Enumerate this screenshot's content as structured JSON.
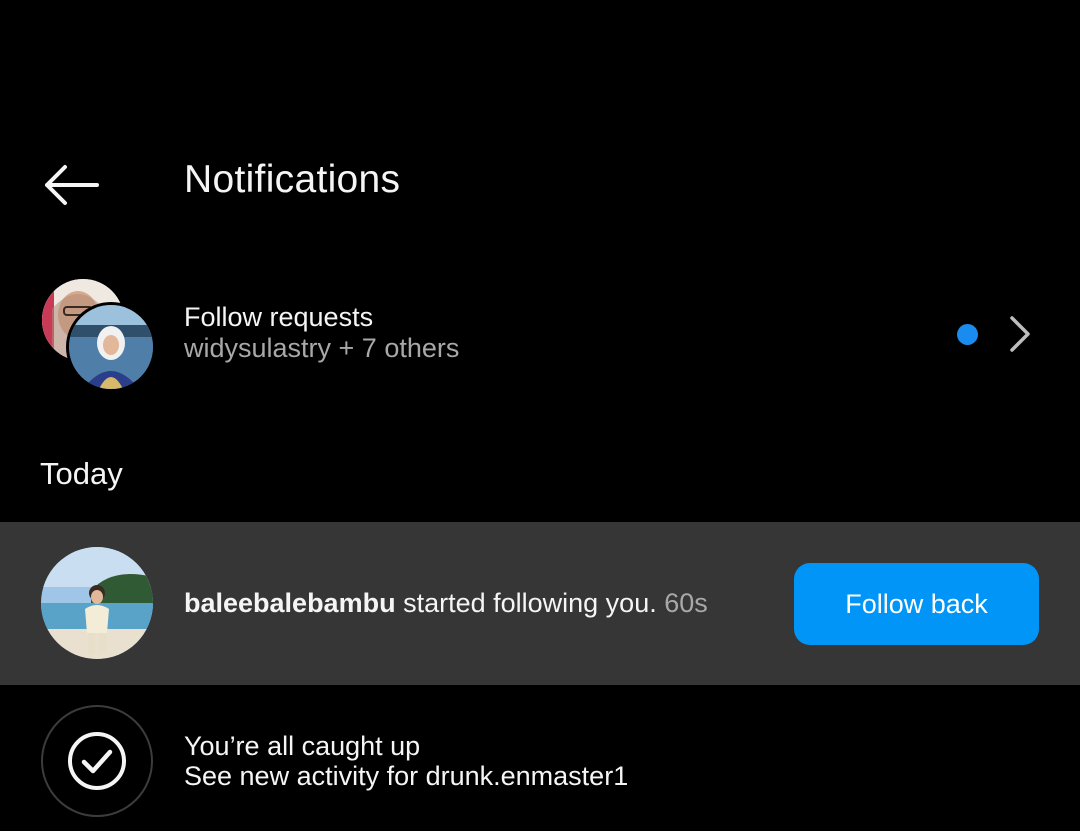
{
  "header": {
    "title": "Notifications",
    "back_icon": "arrow-left-icon"
  },
  "follow_requests": {
    "title": "Follow requests",
    "subtitle": "widysulastry + 7 others",
    "unread_dot_color": "#1a8cf0",
    "chevron_icon": "chevron-right-icon"
  },
  "sections": {
    "today_label": "Today"
  },
  "notification": {
    "username": "baleebalebambu",
    "action": " started following you. ",
    "time": "60s",
    "button_label": "Follow back",
    "button_color": "#0095f6"
  },
  "caught_up": {
    "title": "You’re all caught up",
    "subtitle": "See new activity for drunk.enmaster1",
    "icon": "check-circle-icon"
  },
  "colors": {
    "background": "#000000",
    "highlight_row": "#363636",
    "secondary_text": "#a8a8a8",
    "accent": "#0095f6"
  }
}
